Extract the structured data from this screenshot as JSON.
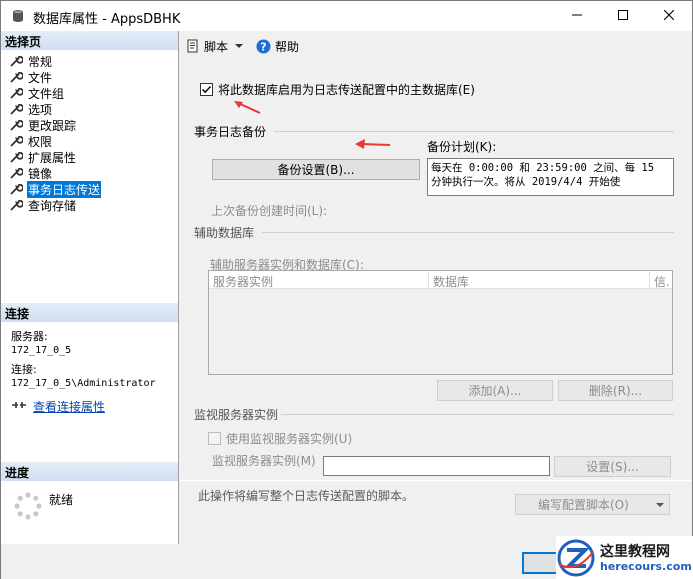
{
  "window": {
    "title": "数据库属性 - AppsDBHK"
  },
  "left": {
    "select_page_header": "选择页",
    "pages": [
      {
        "label": "常规"
      },
      {
        "label": "文件"
      },
      {
        "label": "文件组"
      },
      {
        "label": "选项"
      },
      {
        "label": "更改跟踪"
      },
      {
        "label": "权限"
      },
      {
        "label": "扩展属性"
      },
      {
        "label": "镜像"
      },
      {
        "label": "事务日志传送",
        "selected": true
      },
      {
        "label": "查询存储"
      }
    ],
    "connection_header": "连接",
    "server_label": "服务器:",
    "server_value": "172_17_0_5",
    "connection_label": "连接:",
    "connection_value": "172_17_0_5\\Administrator",
    "view_connection_link": "查看连接属性",
    "progress_header": "进度",
    "progress_status": "就绪"
  },
  "toolbar": {
    "script_label": "脚本",
    "help_label": "帮助"
  },
  "main": {
    "enable_primary_label": "将此数据库启用为日志传送配置中的主数据库(E)",
    "enable_primary_checked": true,
    "tx_backup_group": "事务日志备份",
    "backup_settings_button": "备份设置(B)...",
    "backup_schedule_label": "备份计划(K):",
    "backup_schedule_text": "每天在 0:00:00 和 23:59:00 之间、每 15 分钟执行一次。将从 2019/4/4 开始使",
    "last_backup_label": "上次备份创建时间(L):",
    "secondary_group": "辅助数据库",
    "secondary_list_label": "辅助服务器实例和数据库(C):",
    "grid_columns": [
      "服务器实例",
      "数据库",
      "信."
    ],
    "add_button": "添加(A)...",
    "remove_button": "删除(R)...",
    "monitor_group": "监视服务器实例",
    "use_monitor_label": "使用监视服务器实例(U)",
    "monitor_instance_label": "监视服务器实例(M)",
    "monitor_settings_button": "设置(S)...",
    "script_note": "此操作将编写整个日志传送配置的脚本。",
    "script_config_button": "编写配置脚本(O)"
  },
  "watermark": {
    "main": "这里教程网",
    "sub": "herecours.com"
  },
  "colors": {
    "selection": "#0078d7",
    "annotation_arrow": "#e53935",
    "link": "#0645ad"
  }
}
